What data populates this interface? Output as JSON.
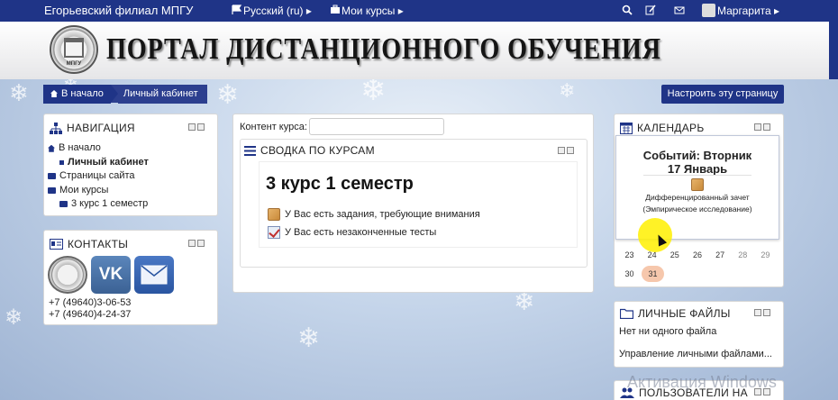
{
  "topbar": {
    "brand": "Егорьевский филиал МПГУ",
    "language": "Русский (ru) ▸",
    "my_courses": "Мои курсы ▸",
    "user": "Маргарита ▸"
  },
  "header": {
    "title": "ПОРТАЛ ДИСТАНЦИОННОГО ОБУЧЕНИЯ",
    "logo_text": "МПГУ"
  },
  "breadcrumb": {
    "home": "В начало",
    "current": "Личный кабинет"
  },
  "customize_button": "Настроить эту страницу",
  "navigation": {
    "title": "НАВИГАЦИЯ",
    "items": [
      "В начало",
      "Личный кабинет",
      "Страницы сайта",
      "Мои курсы",
      "3 курс 1 семестр"
    ]
  },
  "contacts": {
    "title": "КОНТАКТЫ",
    "vk": "VK",
    "phone1": "+7 (49640)3-06-53",
    "phone2": "+7 (49640)4-24-37"
  },
  "content": {
    "field_label": "Контент курса:",
    "overview_title": "СВОДКА ПО КУРСАМ",
    "course_name": "3 курс 1 семестр",
    "notice1": "У Вас есть задания, требующие внимания",
    "notice2": "У Вас есть незаконченные тесты"
  },
  "calendar": {
    "title": "КАЛЕНДАРЬ",
    "popup_heading_1": "Событий: Вторник",
    "popup_heading_2": "17 Январь",
    "event_1": "Дифференцированный зачет",
    "event_2": "(Эмпирическое исследование)",
    "row1": [
      "23",
      "24",
      "25",
      "26",
      "27",
      "28",
      "29"
    ],
    "row2": [
      "30",
      "31"
    ],
    "today": "31"
  },
  "private_files": {
    "title": "ЛИЧНЫЕ ФАЙЛЫ",
    "empty": "Нет ни одного файла",
    "manage": "Управление личными файлами..."
  },
  "users_block": {
    "title": "ПОЛЬЗОВАТЕЛИ НА"
  },
  "watermark": "Активация Windows",
  "colors": {
    "primary": "#1f3487",
    "today": "#f6c7ac"
  }
}
